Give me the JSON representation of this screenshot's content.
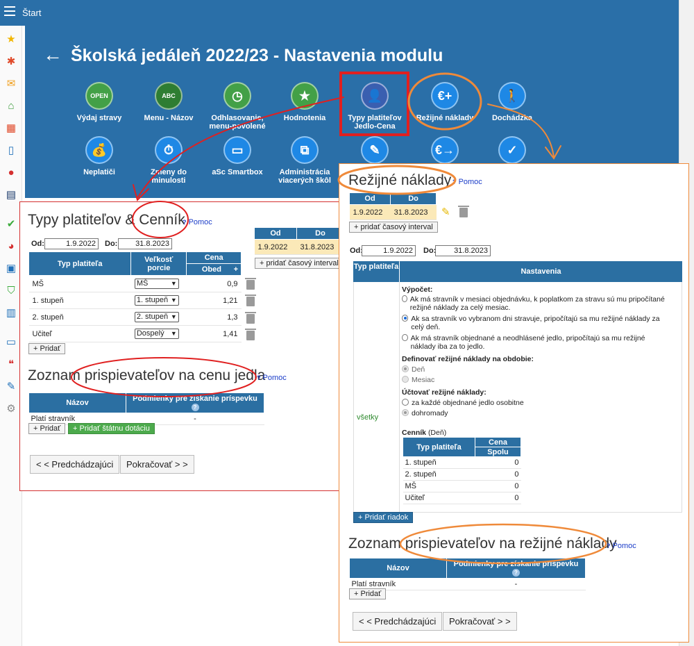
{
  "topbar": {
    "menu_icon": "hamburger-icon",
    "start_label": "Štart"
  },
  "sidebar": {
    "icons": [
      "star-icon",
      "palm-icon",
      "mail-icon",
      "home-icon",
      "calendar-icon",
      "phone-icon",
      "person-icon",
      "cash-register-icon",
      "check-icon",
      "chart-pie-icon",
      "briefcase-icon",
      "shield-check-icon",
      "bar-chart-icon",
      "book-icon",
      "chat-icon",
      "pen-icon",
      "gear-icon"
    ]
  },
  "header": {
    "back_icon": "arrow-left-icon",
    "title": "Školská jedáleň 2022/23 - Nastavenia modulu",
    "modules_row1": [
      {
        "label": "Výdaj stravy",
        "icon": "open-sign-icon",
        "glyph": "OPEN",
        "color": "#43a047"
      },
      {
        "label": "Menu - Názov",
        "icon": "abc-board-icon",
        "glyph": "ABC",
        "color": "#2e7d32"
      },
      {
        "label": "Odhlasovanie, menu-povolené",
        "icon": "clock-icon",
        "glyph": "◷",
        "color": "#43a047"
      },
      {
        "label": "Hodnotenia",
        "icon": "star-icon",
        "glyph": "★",
        "color": "#43a047"
      },
      {
        "label": "Typy platiteľov Jedlo-Cena",
        "icon": "person-money-icon",
        "glyph": "👤",
        "color": "#3a5fb0"
      },
      {
        "label": "Režijné náklady",
        "icon": "euro-plus-icon",
        "glyph": "€+",
        "color": "#1e88e5"
      },
      {
        "label": "Dochádzka",
        "icon": "walking-icon",
        "glyph": "🚶",
        "color": "#1e88e5"
      }
    ],
    "modules_row2": [
      {
        "label": "Neplatiči",
        "icon": "moneybag-icon",
        "glyph": "💰",
        "color": "#1e88e5"
      },
      {
        "label": "Zmeny do minulosti",
        "icon": "clock-history-icon",
        "glyph": "⏱",
        "color": "#1e88e5"
      },
      {
        "label": "aSc Smartbox",
        "icon": "monitor-icon",
        "glyph": "▭",
        "color": "#1e88e5"
      },
      {
        "label": "Administrácia viacerých škôl",
        "icon": "org-chart-icon",
        "glyph": "⧉",
        "color": "#1e88e5"
      },
      {
        "label": "",
        "icon": "payment-icon",
        "glyph": "✎",
        "color": "#1e88e5"
      },
      {
        "label": "",
        "icon": "euro-arrow-icon",
        "glyph": "€→",
        "color": "#1e88e5"
      },
      {
        "label": "",
        "icon": "check-circle-icon",
        "glyph": "✓",
        "color": "#1e88e5"
      }
    ]
  },
  "left_panel": {
    "title": "Typy platiteľov & Cenník",
    "help_label": "Pomoc",
    "od_label": "Od:",
    "od_value": "1.9.2022",
    "do_label": "Do:",
    "do_value": "31.8.2023",
    "interval_table": {
      "headers": [
        "Od",
        "Do"
      ],
      "row": [
        "1.9.2022",
        "31.8.2023"
      ],
      "add_label": "+ pridať časový interval"
    },
    "price_table": {
      "headers": [
        "Typ platiteľa",
        "Veľkosť porcie",
        "Cena"
      ],
      "subheader": "Obed",
      "rows": [
        {
          "type": "MŠ",
          "portion": "MŠ",
          "price": "0,9"
        },
        {
          "type": "1. stupeň",
          "portion": "1. stupeň",
          "price": "1,21"
        },
        {
          "type": "2. stupeň",
          "portion": "2. stupeň",
          "price": "1,3"
        },
        {
          "type": "Učiteľ",
          "portion": "Dospelý",
          "price": "1,41"
        }
      ]
    },
    "add_label": "+ Pridať",
    "contrib_title": "Zoznam prispievateľov na cenu jedla",
    "contrib_help": "Pomoc",
    "contrib_table": {
      "headers": [
        "Názov",
        "Podmienky pre získanie príspevku"
      ],
      "rows": [
        [
          "Platí stravník",
          "-"
        ]
      ]
    },
    "contrib_add": "+ Pridať",
    "state_add": "+ Pridať štátnu dotáciu",
    "prev_label": "< < Predchádzajúci",
    "next_label": "Pokračovať > >"
  },
  "right_panel": {
    "title": "Režijné náklady",
    "help_label": "Pomoc",
    "interval_table": {
      "headers": [
        "Od",
        "Do"
      ],
      "row": [
        "1.9.2022",
        "31.8.2023"
      ],
      "add_label": "+ pridať časový interval"
    },
    "od_label": "Od:",
    "od_value": "1.9.2022",
    "do_label": "Do:",
    "do_value": "31.8.2023",
    "settings_headers": [
      "Typ platiteľa",
      "Nastavenia"
    ],
    "row_label": "všetky",
    "vypocet_label": "Výpočet:",
    "vypocet_options": [
      "Ak má stravník v mesiaci objednávku, k poplatkom za stravu sú mu pripočítané režijné náklady za celý mesiac.",
      "Ak sa stravník vo vybranom dni stravuje, pripočítajú sa mu režijné náklady za celý deň.",
      "Ak má stravník objednané a neodhlásené jedlo, pripočítajú sa mu režijné náklady iba za to jedlo."
    ],
    "obdobie_label": "Definovať režijné náklady na obdobie:",
    "obdobie_options": [
      "Deň",
      "Mesiac"
    ],
    "uctovat_label": "Účtovať režijné náklady:",
    "uctovat_options": [
      "za každé objednané jedlo osobitne",
      "dohromady"
    ],
    "cennik_label": "Cenník",
    "cennik_suffix": "(Deň)",
    "cennik_headers": [
      "Typ platiteľa",
      "Cena",
      "Spolu"
    ],
    "cennik_rows": [
      [
        "1. stupeň",
        "0"
      ],
      [
        "2. stupeň",
        "0"
      ],
      [
        "MŠ",
        "0"
      ],
      [
        "Učiteľ",
        "0"
      ]
    ],
    "add_row_label": "+ Pridať riadok",
    "contrib_title": "Zoznam prispievateľov na režijné náklady",
    "contrib_help": "Pomoc",
    "contrib_table": {
      "headers": [
        "Názov",
        "Podmienky pre získanie príspevku"
      ],
      "rows": [
        [
          "Platí stravník",
          "-"
        ]
      ]
    },
    "contrib_add": "+ Pridať",
    "prev_label": "< < Predchádzajúci",
    "next_label": "Pokračovať > >"
  },
  "colors": {
    "brand": "#2a6fa8",
    "annotation_red": "#e02020",
    "annotation_orange": "#ef8a3a",
    "add_green": "#4caa4c"
  }
}
